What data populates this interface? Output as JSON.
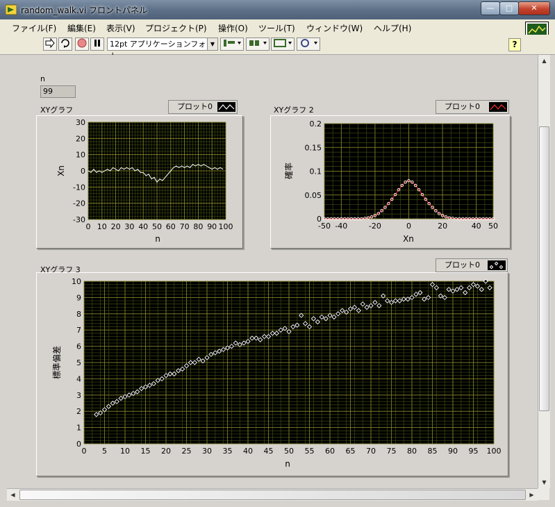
{
  "window": {
    "title": "random_walk.vi フロントパネル",
    "minimize": "—",
    "maximize": "□",
    "close": "✕"
  },
  "menu": [
    "ファイル(F)",
    "編集(E)",
    "表示(V)",
    "プロジェクト(P)",
    "操作(O)",
    "ツール(T)",
    "ウィンドウ(W)",
    "ヘルプ(H)"
  ],
  "toolbar": {
    "font": "12pt アプリケーションフォント",
    "help": "?",
    "run_icon": "run-arrow-icon",
    "run_continuous_icon": "run-continuous-icon",
    "abort_icon": "abort-icon",
    "pause_icon": "pause-icon"
  },
  "vi_icon_number": "1",
  "controls": {
    "n_label": "n",
    "n_value": "99"
  },
  "chart_data": [
    {
      "type": "line",
      "title": "XYグラフ",
      "legend": "プロット0",
      "xlabel": "n",
      "ylabel": "Xn",
      "xlim": [
        0,
        100
      ],
      "ylim": [
        -30,
        30
      ],
      "xticks": [
        0,
        10,
        20,
        30,
        40,
        50,
        60,
        70,
        80,
        90,
        100
      ],
      "yticks": [
        -30,
        -20,
        -10,
        0,
        10,
        20,
        30
      ],
      "grid": true,
      "series": [
        {
          "x": [
            0,
            2,
            4,
            6,
            8,
            10,
            12,
            14,
            16,
            18,
            20,
            22,
            24,
            26,
            28,
            30,
            32,
            34,
            36,
            38,
            40,
            42,
            44,
            46,
            48,
            50,
            52,
            54,
            56,
            58,
            60,
            62,
            64,
            66,
            68,
            70,
            72,
            74,
            76,
            78,
            80,
            82,
            84,
            86,
            88,
            90,
            92,
            94,
            96,
            98
          ],
          "values": [
            0,
            -1,
            1,
            -1,
            0,
            -1,
            0,
            1,
            0,
            2,
            1,
            0,
            2,
            1,
            2,
            1,
            2,
            0,
            1,
            -1,
            -1,
            -3,
            -2,
            -5,
            -4,
            -7,
            -5,
            -6,
            -4,
            -2,
            0,
            2,
            3,
            2,
            3,
            2,
            3,
            2,
            4,
            3,
            4,
            3,
            4,
            3,
            2,
            1,
            2,
            1,
            2,
            1
          ]
        }
      ]
    },
    {
      "type": "scatter",
      "title": "XYグラフ 2",
      "legend": "プロット0",
      "xlabel": "Xn",
      "ylabel": "確率",
      "xlim": [
        -50,
        50
      ],
      "ylim": [
        0,
        0.2
      ],
      "xticks": [
        -50,
        -40,
        -20,
        0,
        20,
        40,
        50
      ],
      "yticks": [
        0,
        0.05,
        0.1,
        0.15,
        0.2
      ],
      "grid": true,
      "series": [
        {
          "x": [
            -50,
            -48,
            -46,
            -44,
            -42,
            -40,
            -38,
            -36,
            -34,
            -32,
            -30,
            -28,
            -26,
            -24,
            -22,
            -20,
            -18,
            -16,
            -14,
            -12,
            -10,
            -8,
            -6,
            -4,
            -2,
            0,
            2,
            4,
            6,
            8,
            10,
            12,
            14,
            16,
            18,
            20,
            22,
            24,
            26,
            28,
            30,
            32,
            34,
            36,
            38,
            40,
            42,
            44,
            46,
            48,
            50
          ],
          "values": [
            0,
            0,
            0,
            0,
            0,
            0,
            0,
            0,
            0,
            0,
            0,
            0,
            0.001,
            0.002,
            0.004,
            0.007,
            0.011,
            0.017,
            0.024,
            0.032,
            0.041,
            0.051,
            0.061,
            0.07,
            0.077,
            0.08,
            0.077,
            0.07,
            0.061,
            0.051,
            0.041,
            0.032,
            0.024,
            0.017,
            0.011,
            0.007,
            0.004,
            0.002,
            0.001,
            0,
            0,
            0,
            0,
            0,
            0,
            0,
            0,
            0,
            0,
            0,
            0
          ]
        }
      ]
    },
    {
      "type": "scatter",
      "title": "XYグラフ 3",
      "legend": "プロット0",
      "xlabel": "n",
      "ylabel": "標準偏差",
      "xlim": [
        0,
        100
      ],
      "ylim": [
        0,
        10
      ],
      "xticks": [
        0,
        5,
        10,
        15,
        20,
        25,
        30,
        35,
        40,
        45,
        50,
        55,
        60,
        65,
        70,
        75,
        80,
        85,
        90,
        95,
        100
      ],
      "yticks": [
        0,
        1,
        2,
        3,
        4,
        5,
        6,
        7,
        8,
        9,
        10
      ],
      "grid": true,
      "series": [
        {
          "x": [
            3,
            4,
            5,
            6,
            7,
            8,
            9,
            10,
            11,
            12,
            13,
            14,
            15,
            16,
            17,
            18,
            19,
            20,
            21,
            22,
            23,
            24,
            25,
            26,
            27,
            28,
            29,
            30,
            31,
            32,
            33,
            34,
            35,
            36,
            37,
            38,
            39,
            40,
            41,
            42,
            43,
            44,
            45,
            46,
            47,
            48,
            49,
            50,
            51,
            52,
            53,
            54,
            55,
            56,
            57,
            58,
            59,
            60,
            61,
            62,
            63,
            64,
            65,
            66,
            67,
            68,
            69,
            70,
            71,
            72,
            73,
            74,
            75,
            76,
            77,
            78,
            79,
            80,
            81,
            82,
            83,
            84,
            85,
            86,
            87,
            88,
            89,
            90,
            91,
            92,
            93,
            94,
            95,
            96,
            97,
            98,
            99
          ],
          "values": [
            1.8,
            1.9,
            2.1,
            2.3,
            2.5,
            2.6,
            2.8,
            2.9,
            3.0,
            3.1,
            3.2,
            3.4,
            3.5,
            3.6,
            3.7,
            3.9,
            4.0,
            4.2,
            4.3,
            4.3,
            4.5,
            4.6,
            4.8,
            5.0,
            5.0,
            5.2,
            5.1,
            5.3,
            5.5,
            5.6,
            5.7,
            5.8,
            5.9,
            6.0,
            6.2,
            6.1,
            6.2,
            6.3,
            6.5,
            6.5,
            6.4,
            6.6,
            6.6,
            6.8,
            6.8,
            7.0,
            7.1,
            6.9,
            7.2,
            7.3,
            7.9,
            7.4,
            7.2,
            7.7,
            7.5,
            7.8,
            7.7,
            7.9,
            7.8,
            8.0,
            8.2,
            8.1,
            8.3,
            8.4,
            8.2,
            8.6,
            8.4,
            8.5,
            8.7,
            8.5,
            9.1,
            8.8,
            8.7,
            8.8,
            8.8,
            8.9,
            8.9,
            9.0,
            9.2,
            9.3,
            8.9,
            9.0,
            9.8,
            9.6,
            9.1,
            9.0,
            9.5,
            9.4,
            9.5,
            9.6,
            9.3,
            9.6,
            9.8,
            9.7,
            9.5,
            10.0,
            9.6
          ]
        }
      ]
    }
  ]
}
